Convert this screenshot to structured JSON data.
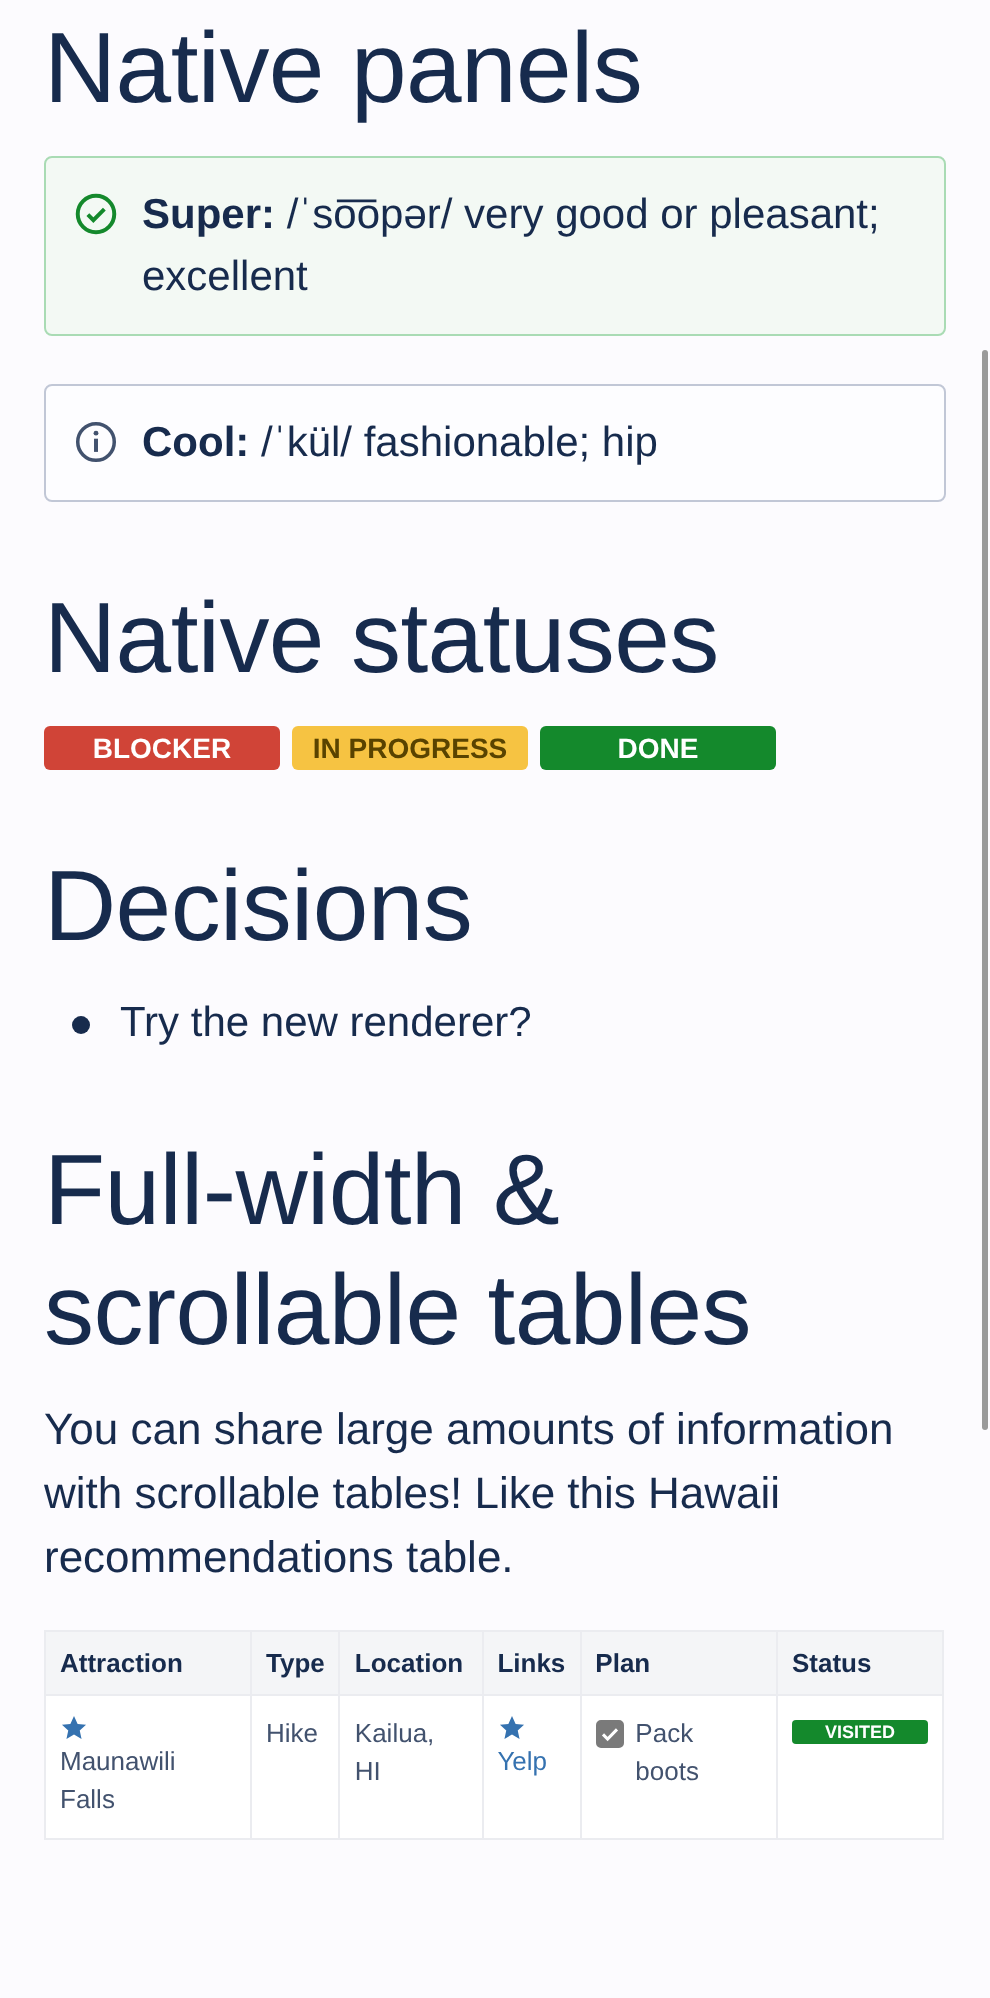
{
  "sections": [
    {
      "heading": "Native panels",
      "panels": [
        {
          "kind": "success",
          "text": "**Super:** /ˈso͞opər/ very good or pleasant; excellent"
        },
        {
          "kind": "info",
          "text": "**Cool:** /ˈkül/ fashionable; hip"
        }
      ]
    },
    {
      "heading": "Native statuses",
      "statuses": [
        {
          "label": "BLOCKER",
          "color": "#d04437"
        },
        {
          "label": "IN PROGRESS",
          "color": "#f6c342"
        },
        {
          "label": "DONE",
          "color": "#14892c"
        }
      ]
    },
    {
      "heading": "Decisions",
      "decisions": [
        "Try the new renderer?"
      ]
    },
    {
      "heading": "Full-width & scrollable tables",
      "paragraph": "You can share large amounts of information with scrollable tables! Like this Hawaii recommendations table.",
      "table": {
        "columns": [
          "Attraction",
          "Type",
          "Location",
          "Links",
          "Plan",
          "Status"
        ],
        "rows": [
          [
            {
              "kind": "starred",
              "text": "Maunawili Falls"
            },
            {
              "kind": "text",
              "text": "Hike"
            },
            {
              "kind": "text",
              "text": "Kailua, HI"
            },
            {
              "kind": "starlink",
              "text": "Yelp"
            },
            {
              "kind": "task",
              "text": "Pack boots",
              "checked": true
            },
            {
              "kind": "status",
              "text": "VISITED",
              "color": "#14892c"
            }
          ]
        ]
      }
    }
  ]
}
